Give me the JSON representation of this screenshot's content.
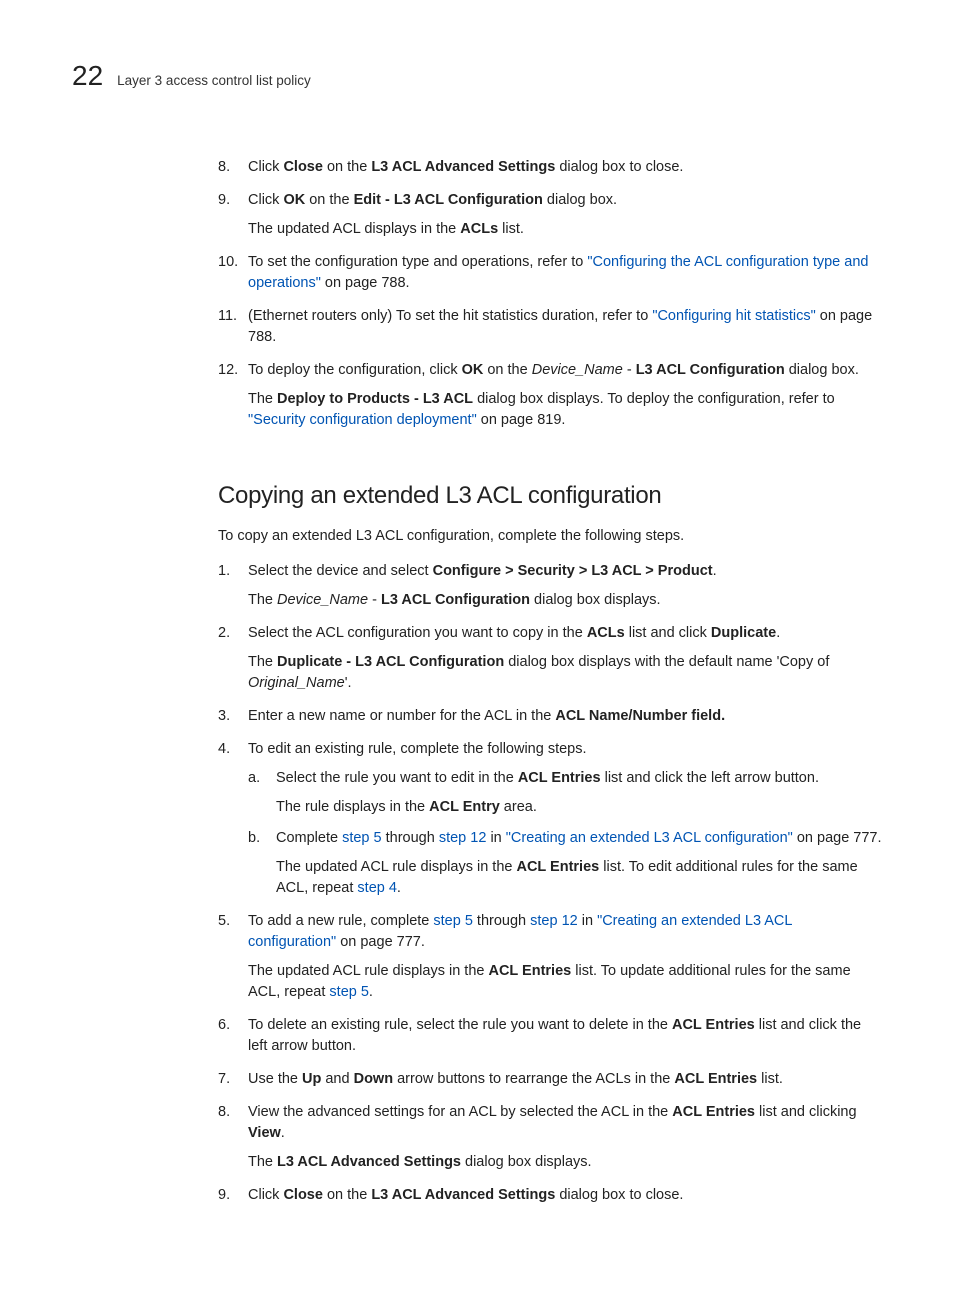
{
  "header": {
    "page_number": "22",
    "running_title": "Layer 3 access control list policy"
  },
  "top_list": {
    "i8": {
      "n": "8.",
      "p1a": "Click ",
      "p1b": "Close",
      "p1c": " on the ",
      "p1d": "L3 ACL Advanced Settings",
      "p1e": " dialog box to close."
    },
    "i9": {
      "n": "9.",
      "p1a": "Click ",
      "p1b": "OK",
      "p1c": " on the ",
      "p1d": "Edit - L3 ACL Configuration",
      "p1e": " dialog box.",
      "s2a": "The updated ACL displays in the ",
      "s2b": "ACLs",
      "s2c": " list."
    },
    "i10": {
      "n": "10.",
      "p1a": "To set the configuration type and operations, refer to ",
      "p1b": "\"Configuring the ACL configuration type and operations\"",
      "p1c": " on page 788."
    },
    "i11": {
      "n": "11.",
      "p1a": "(Ethernet routers only) To set the hit statistics duration, refer to ",
      "p1b": "\"Configuring hit statistics\"",
      "p1c": " on page 788."
    },
    "i12": {
      "n": "12.",
      "p1a": "To deploy the configuration, click ",
      "p1b": "OK",
      "p1c": " on the ",
      "p1d": "Device_Name",
      "p1e": " - ",
      "p1f": "L3 ACL Configuration",
      "p1g": " dialog box.",
      "s2a": "The ",
      "s2b": "Deploy to Products - L3 ACL",
      "s2c": " dialog box displays. To deploy the configuration, refer to ",
      "s2d": "\"Security configuration deployment\"",
      "s2e": " on page 819."
    }
  },
  "section": {
    "heading": "Copying an extended L3 ACL configuration",
    "lead": "To copy an extended L3 ACL configuration, complete the following steps."
  },
  "steps": {
    "s1": {
      "n": "1.",
      "p1a": "Select the device and select ",
      "p1b": "Configure > Security > L3 ACL > Product",
      "p1c": ".",
      "s2a": "The ",
      "s2b": "Device_Name",
      "s2c": " - ",
      "s2d": "L3 ACL Configuration",
      "s2e": " dialog box displays."
    },
    "s2": {
      "n": "2.",
      "p1a": "Select the ACL configuration you want to copy in the ",
      "p1b": "ACLs",
      "p1c": " list and click ",
      "p1d": "Duplicate",
      "p1e": ".",
      "s2a": "The ",
      "s2b": "Duplicate - L3 ACL Configuration",
      "s2c": " dialog box displays with the default name 'Copy of ",
      "s2d": "Original_Name",
      "s2e": "'."
    },
    "s3": {
      "n": "3.",
      "p1a": "Enter a new name or number for the ACL in the ",
      "p1b": "ACL Name/Number field."
    },
    "s4": {
      "n": "4.",
      "p1": "To edit an existing rule, complete the following steps.",
      "a": {
        "an": "a.",
        "p1a": "Select the rule you want to edit in the ",
        "p1b": "ACL Entries",
        "p1c": " list and click the left arrow button.",
        "s2a": "The rule displays in the ",
        "s2b": "ACL Entry",
        "s2c": " area."
      },
      "b": {
        "an": "b.",
        "p1a": "Complete ",
        "p1b": "step 5",
        "p1c": " through ",
        "p1d": "step 12",
        "p1e": " in ",
        "p1f": "\"Creating an extended L3 ACL configuration\"",
        "p1g": " on page 777.",
        "s2a": "The updated ACL rule displays in the ",
        "s2b": "ACL Entries",
        "s2c": " list. To edit additional rules for the same ACL, repeat ",
        "s2d": "step 4",
        "s2e": "."
      }
    },
    "s5": {
      "n": "5.",
      "p1a": "To add a new rule, complete ",
      "p1b": "step 5",
      "p1c": " through ",
      "p1d": "step 12",
      "p1e": " in ",
      "p1f": "\"Creating an extended L3 ACL configuration\"",
      "p1g": " on page 777.",
      "s2a": "The updated ACL rule displays in the ",
      "s2b": "ACL Entries",
      "s2c": " list. To update additional rules for the same ACL, repeat ",
      "s2d": "step 5",
      "s2e": "."
    },
    "s6": {
      "n": "6.",
      "p1a": "To delete an existing rule, select the rule you want to delete in the ",
      "p1b": "ACL Entries",
      "p1c": " list and click the left arrow button."
    },
    "s7": {
      "n": "7.",
      "p1a": "Use the ",
      "p1b": "Up",
      "p1c": " and ",
      "p1d": "Down",
      "p1e": " arrow buttons to rearrange the ACLs in the ",
      "p1f": "ACL Entries",
      "p1g": " list."
    },
    "s8": {
      "n": "8.",
      "p1a": "View the advanced settings for an ACL by selected the ACL in the ",
      "p1b": "ACL Entries",
      "p1c": " list and clicking ",
      "p1d": "View",
      "p1e": ".",
      "s2a": "The ",
      "s2b": "L3 ACL Advanced Settings",
      "s2c": " dialog box displays."
    },
    "s9": {
      "n": "9.",
      "p1a": "Click ",
      "p1b": "Close",
      "p1c": " on the ",
      "p1d": "L3 ACL Advanced Settings",
      "p1e": " dialog box to close."
    }
  }
}
